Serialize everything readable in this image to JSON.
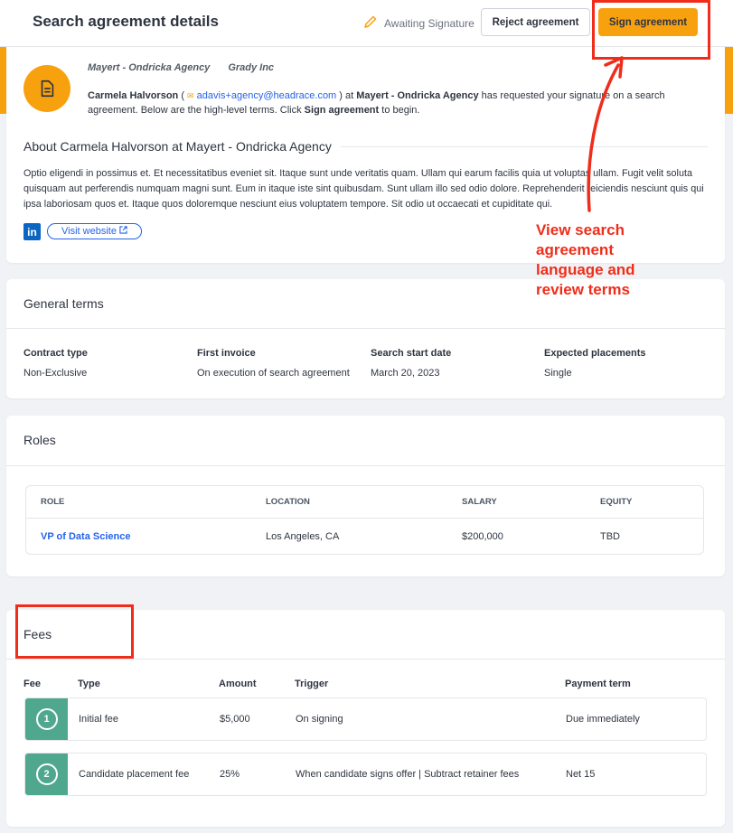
{
  "header": {
    "title": "Search agreement details",
    "status": "Awaiting Signature",
    "reject_label": "Reject agreement",
    "sign_label": "Sign agreement"
  },
  "intro": {
    "agency": "Mayert - Ondricka Agency",
    "company": "Grady Inc",
    "requester_name": "Carmela Halvorson",
    "requester_email": "adavis+agency@headrace.com",
    "text_at": "at",
    "text_agency": "Mayert - Ondricka Agency",
    "text_requested": "has requested your signature on a search agreement. Below are the high-level terms. Click",
    "text_sign": "Sign agreement",
    "text_begin": "to begin."
  },
  "about": {
    "heading": "About Carmela Halvorson at Mayert - Ondricka Agency",
    "body": "Optio eligendi in possimus et. Et necessitatibus eveniet sit. Itaque sunt unde veritatis quam. Ullam qui earum facilis quia ut voluptas ullam. Fugit velit soluta quisquam aut perferendis numquam magni sunt. Eum in itaque iste sint quibusdam. Sunt ullam illo sed odio dolore. Reprehenderit reiciendis nesciunt quis qui ipsa laboriosam quos et. Itaque quos doloremque nesciunt eius voluptatem tempore. Sit odio ut occaecati et cupiditate qui.",
    "linkedin_label": "in",
    "visit_label": "Visit website"
  },
  "general_terms": {
    "title": "General terms",
    "items": [
      {
        "label": "Contract type",
        "value": "Non-Exclusive"
      },
      {
        "label": "First invoice",
        "value": "On execution of search agreement"
      },
      {
        "label": "Search start date",
        "value": "March 20, 2023"
      },
      {
        "label": "Expected placements",
        "value": "Single"
      }
    ]
  },
  "roles": {
    "title": "Roles",
    "columns": [
      "ROLE",
      "LOCATION",
      "SALARY",
      "EQUITY"
    ],
    "rows": [
      {
        "role": "VP of Data Science",
        "location": "Los Angeles, CA",
        "salary": "$200,000",
        "equity": "TBD"
      }
    ]
  },
  "fees": {
    "title": "Fees",
    "columns": [
      "Fee",
      "Type",
      "Amount",
      "Trigger",
      "Payment term"
    ],
    "rows": [
      {
        "num": "1",
        "type": "Initial fee",
        "amount": "$5,000",
        "trigger": "On signing",
        "term": "Due immediately"
      },
      {
        "num": "2",
        "type": "Candidate placement fee",
        "amount": "25%",
        "trigger": "When candidate signs offer | Subtract retainer fees",
        "term": "Net 15"
      }
    ]
  },
  "annotation": {
    "lines": [
      "View search",
      "agreement",
      "language and",
      "review terms"
    ],
    "color": "#ef2d1a"
  },
  "colors": {
    "accent": "#f8a10f",
    "link": "#2563eb",
    "fee_badge": "#4fa88e"
  }
}
